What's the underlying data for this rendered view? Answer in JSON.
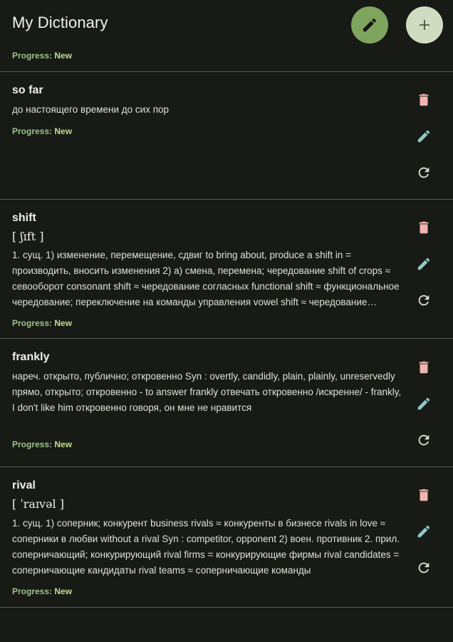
{
  "header": {
    "title": "My Dictionary",
    "progress_label": "Progress:",
    "progress_value": "New",
    "edit_icon": "pencil-icon",
    "add_icon": "plus-icon"
  },
  "colors": {
    "background": "#181a16",
    "accent_green": "#7ea45d",
    "accent_light": "#cfdcbf",
    "delete_icon": "#f0b4b0",
    "edit_icon": "#8fc9c4",
    "reset_icon": "#d9dcd3",
    "progress": "#b8d98a"
  },
  "entries": [
    {
      "word": "so far",
      "transcription": "",
      "definition": "до настоящего времени до сих пор",
      "progress_label": "Progress:",
      "progress_value": "New"
    },
    {
      "word": "shift",
      "transcription": "[ ʃɪft ]",
      "definition": "1. сущ. 1) изменение, перемещение, сдвиг to bring about, produce a shift in = производить, вносить изменения 2) а) смена, перемена; чередование shift of crops ≈ севооборот consonant shift ≈ чередование согласных functional shift ≈ функциональное чередование; переключение на команды управления vowel shift ≈ чередование гласных",
      "progress_label": "Progress:",
      "progress_value": "New"
    },
    {
      "word": "frankly",
      "transcription": "",
      "definition": "нареч. открыто, публично; откровенно Syn : overtly, candidly, plain, plainly, unreservedly прямо, открыто; откровенно - to answer frankly отвечать откровенно /искренне/ - frankly, I don't like him откровенно говоря, он мне не нравится",
      "progress_label": "Progress:",
      "progress_value": "New"
    },
    {
      "word": "rival",
      "transcription": "[ ˈraɪvəl ]",
      "definition": "1. сущ. 1) соперник; конкурент business rivals ≈ конкуренты в бизнесе rivals in love ≈ соперники в любви without a rival Syn : competitor, opponent 2) воен. противник 2. прил. соперничающий; конкурирующий rival firms = конкурирующие фирмы rival candidates = соперничающие кандидаты rival teams ≈ соперничающие команды",
      "progress_label": "Progress:",
      "progress_value": "New"
    }
  ],
  "actions": {
    "delete_icon": "trash-icon",
    "edit_icon": "pencil-icon",
    "reset_icon": "refresh-icon"
  }
}
